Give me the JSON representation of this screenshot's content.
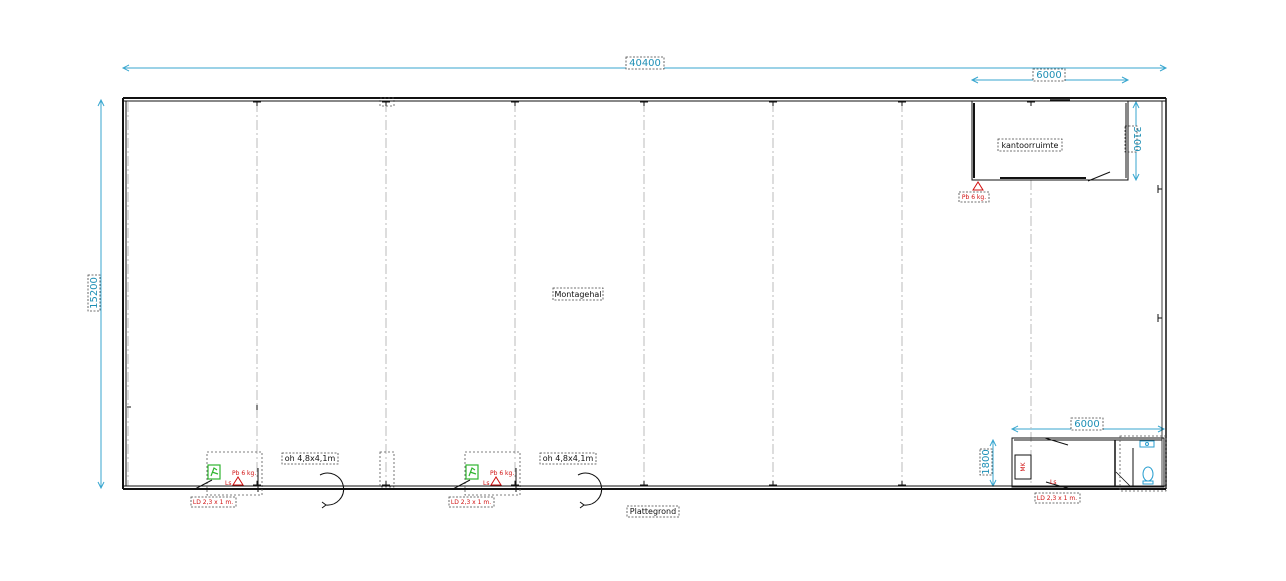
{
  "dimensions": {
    "overall_width": "40400",
    "overall_height": "15200",
    "office_width": "6000",
    "office_height": "3100",
    "sanitary_width": "6000",
    "sanitary_height": "1800"
  },
  "rooms": {
    "hall": "Montagehal",
    "office": "kantoorruimte",
    "plan_title": "Plattegrond"
  },
  "doors": {
    "overhead_1": "oh  4,8x4,1m",
    "overhead_2": "oh  4,8x4,1m",
    "loading_door_1": "LD  2,3 x 1 m.",
    "loading_door_2": "LD  2,3 x 1 m.",
    "loading_door_3": "LD  2,3 x 1 m."
  },
  "safety": {
    "extinguisher_1": "Pb 6 kg.",
    "extinguisher_2": "Pb 6 kg.",
    "extinguisher_office": "Pb 6 kg.",
    "hose_label_1": "Ls",
    "hose_label_2": "Ls",
    "hose_label_3": "Ls",
    "mk_label": "MK"
  },
  "colors": {
    "dimension": "#37a6cf",
    "safety": "#d01010",
    "escape": "#2fb52f",
    "wall": "#111111"
  }
}
